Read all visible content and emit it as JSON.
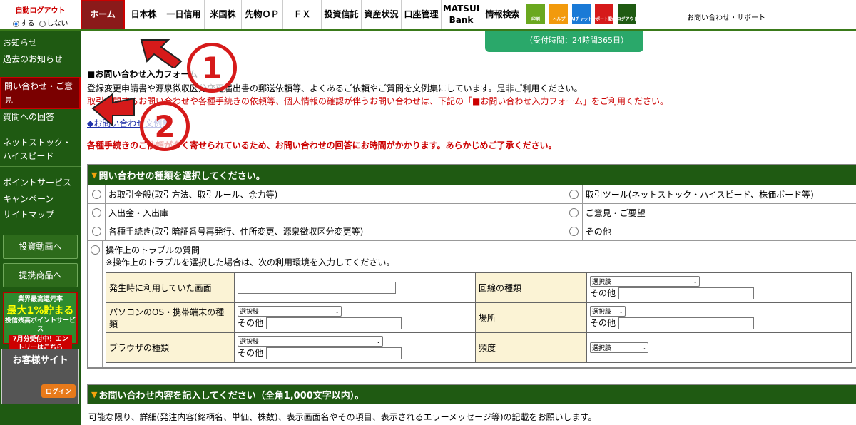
{
  "autologout": {
    "title": "自動ログアウト",
    "opt_on": "する",
    "opt_off": "しない"
  },
  "nav": [
    {
      "label": "ホーム",
      "w": 62
    },
    {
      "label": "日本株",
      "w": 54
    },
    {
      "label": "一日信用",
      "w": 58
    },
    {
      "label": "米国株",
      "w": 52
    },
    {
      "label": "先物ＯＰ",
      "w": 58
    },
    {
      "label": "ＦＸ",
      "w": 54
    },
    {
      "label": "投資信託",
      "w": 56
    },
    {
      "label": "資産状況",
      "w": 56
    },
    {
      "label": "口座管理",
      "w": 56
    },
    {
      "label": "MATSUI Bank",
      "w": 56
    },
    {
      "label": "情報検索",
      "w": 60
    }
  ],
  "icons": [
    {
      "name": "print-icon",
      "label": "印刷",
      "color": "#6aa81f"
    },
    {
      "name": "help-icon",
      "label": "ヘルプ",
      "color": "#f29a0c"
    },
    {
      "name": "ai-chat-icon",
      "label": "AIチャット",
      "color": "#1a7ad6"
    },
    {
      "name": "support-video-icon",
      "label": "サポート動画",
      "color": "#d61a1a"
    },
    {
      "name": "logout-icon",
      "label": "ログアウト",
      "color": "#1f5a12"
    }
  ],
  "support_link": "お問い合わせ・サポート",
  "sidebar": {
    "items1": [
      "お知らせ",
      "過去のお知らせ"
    ],
    "selected": "問い合わせ・ご意見",
    "items2": [
      "質問への回答"
    ],
    "items3": [
      "ネットストック・ハイスピード"
    ],
    "items4": [
      "ポイントサービス",
      "キャンペーン",
      "サイトマップ"
    ],
    "btn_video": "投資動画へ",
    "btn_products": "提携商品へ",
    "promo": {
      "top": "業界最高還元率",
      "big": "最大1%貯まる",
      "mid": "投信残高ポイントサービス",
      "red": "7月分受付中！エントリーはこちら"
    },
    "customer": {
      "title": "お客様サイト",
      "login": "ログイン"
    }
  },
  "bubble": "（受付時間：24時間365日）",
  "form": {
    "section_title": "■お問い合わせ入力フォーム",
    "line1": "登録変更申請書や源泉徴収区分変更届出書の郵送依頼等、よくあるご依頼やご質問を文例集にしています。是非ご利用ください。",
    "line2": "取引に関するお問い合わせや各種手続きの依頼等、個人情報の確認が伴うお問い合わせは、下記の「■お問い合わせ入力フォーム」をご利用ください。",
    "example_link": "◆お問い合わせ文例集",
    "warning": "各種手続きのご依頼が多く寄せられているため、お問い合わせの回答にお時間がかかります。あらかじめご了承ください。"
  },
  "types": {
    "header": "問い合わせの種類を選択してください。",
    "rows": [
      [
        "お取引全般(取引方法、取引ルール、余力等)",
        "取引ツール(ネットストック・ハイスピード、株価ボード等)"
      ],
      [
        "入出金・入出庫",
        "ご意見・ご要望"
      ],
      [
        "各種手続き(取引暗証番号再発行、住所変更、源泉徴収区分変更等)",
        "その他"
      ]
    ],
    "trouble_title": "操作上のトラブルの質問",
    "trouble_note": "※操作上のトラブルを選択した場合は、次の利用環境を入力してください。",
    "env": {
      "screen": "発生時に利用していた画面",
      "line": "回線の種類",
      "os": "パソコンのOS・携帯端末の種類",
      "place": "場所",
      "browser": "ブラウザの種類",
      "freq": "頻度",
      "select": "選択肢",
      "other": "その他"
    }
  },
  "content": {
    "header": "お問い合わせ内容を記入してください（全角1,000文字以内）。",
    "note": "可能な限り、詳細(発注内容(銘柄名、単価、株数)、表示画面名やその項目、表示されるエラーメッセージ等)の記載をお願いします。"
  },
  "annotations": {
    "one": "1",
    "two": "2",
    "color": "#d61a1a"
  }
}
